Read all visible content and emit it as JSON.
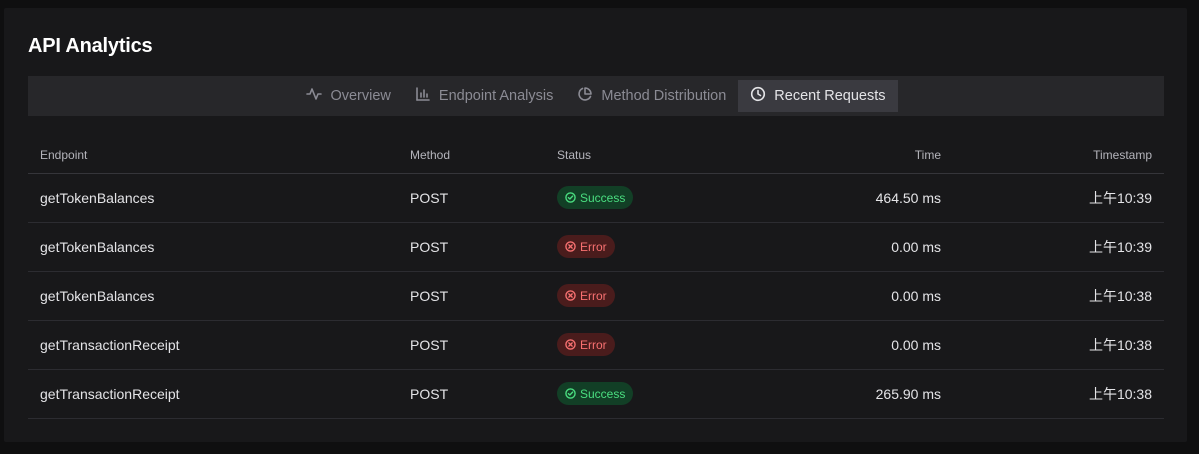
{
  "header": {
    "title": "API Analytics"
  },
  "tabs": [
    {
      "label": "Overview",
      "icon": "activity-icon",
      "active": false
    },
    {
      "label": "Endpoint Analysis",
      "icon": "bar-chart-icon",
      "active": false
    },
    {
      "label": "Method Distribution",
      "icon": "pie-chart-icon",
      "active": false
    },
    {
      "label": "Recent Requests",
      "icon": "clock-icon",
      "active": true
    }
  ],
  "table": {
    "columns": {
      "endpoint": "Endpoint",
      "method": "Method",
      "status": "Status",
      "time": "Time",
      "timestamp": "Timestamp"
    },
    "rows": [
      {
        "endpoint": "getTokenBalances",
        "method": "POST",
        "status": "Success",
        "status_type": "success",
        "time": "464.50 ms",
        "timestamp": "上午10:39"
      },
      {
        "endpoint": "getTokenBalances",
        "method": "POST",
        "status": "Error",
        "status_type": "error",
        "time": "0.00 ms",
        "timestamp": "上午10:39"
      },
      {
        "endpoint": "getTokenBalances",
        "method": "POST",
        "status": "Error",
        "status_type": "error",
        "time": "0.00 ms",
        "timestamp": "上午10:38"
      },
      {
        "endpoint": "getTransactionReceipt",
        "method": "POST",
        "status": "Error",
        "status_type": "error",
        "time": "0.00 ms",
        "timestamp": "上午10:38"
      },
      {
        "endpoint": "getTransactionReceipt",
        "method": "POST",
        "status": "Success",
        "status_type": "success",
        "time": "265.90 ms",
        "timestamp": "上午10:38"
      }
    ]
  },
  "colors": {
    "success": "#4ade80",
    "error": "#f87171",
    "active_tab": "#3a3a40"
  }
}
